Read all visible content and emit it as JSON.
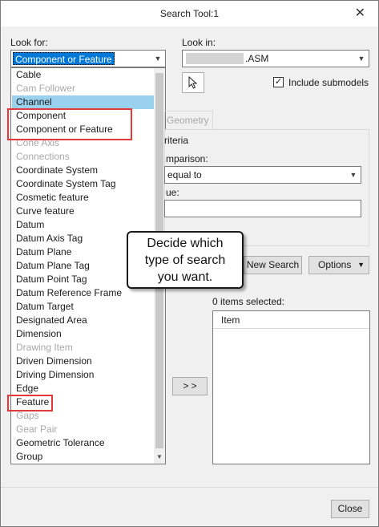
{
  "window": {
    "title": "Search Tool:1"
  },
  "look_for": {
    "label": "Look for:",
    "selected": "Component or Feature",
    "options": [
      {
        "label": "Cable",
        "enabled": true
      },
      {
        "label": "Cam Follower",
        "enabled": false
      },
      {
        "label": "Channel",
        "enabled": true,
        "highlighted": true
      },
      {
        "label": "Component",
        "enabled": true
      },
      {
        "label": "Component or Feature",
        "enabled": true
      },
      {
        "label": "Cone Axis",
        "enabled": false
      },
      {
        "label": "Connections",
        "enabled": false
      },
      {
        "label": "Coordinate System",
        "enabled": true
      },
      {
        "label": "Coordinate System Tag",
        "enabled": true
      },
      {
        "label": "Cosmetic feature",
        "enabled": true
      },
      {
        "label": "Curve feature",
        "enabled": true
      },
      {
        "label": "Datum",
        "enabled": true
      },
      {
        "label": "Datum Axis Tag",
        "enabled": true
      },
      {
        "label": "Datum Plane",
        "enabled": true
      },
      {
        "label": "Datum Plane Tag",
        "enabled": true
      },
      {
        "label": "Datum Point Tag",
        "enabled": true
      },
      {
        "label": "Datum Reference Frame",
        "enabled": true
      },
      {
        "label": "Datum Target",
        "enabled": true
      },
      {
        "label": "Designated Area",
        "enabled": true
      },
      {
        "label": "Dimension",
        "enabled": true
      },
      {
        "label": "Drawing Item",
        "enabled": false
      },
      {
        "label": "Driven Dimension",
        "enabled": true
      },
      {
        "label": "Driving Dimension",
        "enabled": true
      },
      {
        "label": "Edge",
        "enabled": true
      },
      {
        "label": "Feature",
        "enabled": true
      },
      {
        "label": "Gaps",
        "enabled": false
      },
      {
        "label": "Gear Pair",
        "enabled": false
      },
      {
        "label": "Geometric Tolerance",
        "enabled": true
      },
      {
        "label": "Group",
        "enabled": true
      }
    ]
  },
  "look_in": {
    "label": "Look in:",
    "value": ".ASM"
  },
  "include_submodels": {
    "label": "Include submodels",
    "checked": true
  },
  "tab_geometry": "Geometry",
  "criteria": {
    "title": "riteria",
    "comparison_label": "mparison:",
    "comparison_value": "equal to",
    "value_label": "ue:"
  },
  "buttons": {
    "new_search": "New Search",
    "options": "Options",
    "move": "> >",
    "close": "Close"
  },
  "results": {
    "count_text": "0 items selected:",
    "column_item": "Item"
  },
  "callout": {
    "line1": "Decide which",
    "line2": "type of search",
    "line3": "you want."
  },
  "colors": {
    "highlight": "#99d1ef",
    "selection": "#0078d7",
    "annotation": "#e5383b"
  }
}
